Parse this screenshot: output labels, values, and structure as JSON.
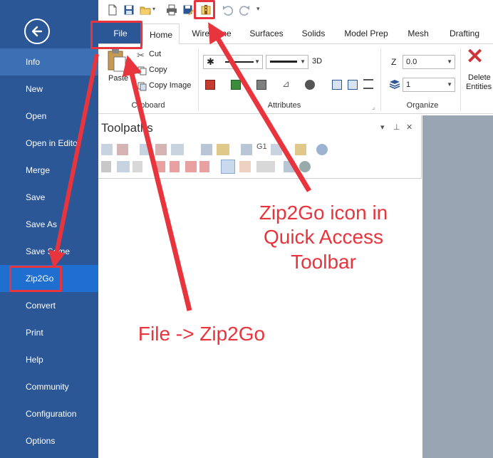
{
  "backstage": {
    "items": [
      {
        "label": "Info"
      },
      {
        "label": "New"
      },
      {
        "label": "Open"
      },
      {
        "label": "Open in Edito"
      },
      {
        "label": "Merge"
      },
      {
        "label": "Save"
      },
      {
        "label": "Save As"
      },
      {
        "label": "Save Some"
      },
      {
        "label": "Zip2Go"
      },
      {
        "label": "Convert"
      },
      {
        "label": "Print"
      },
      {
        "label": "Help"
      },
      {
        "label": "Community"
      },
      {
        "label": "Configuration"
      },
      {
        "label": "Options"
      }
    ],
    "selected": "Info",
    "highlighted": "Zip2Go"
  },
  "tabs": [
    "File",
    "Home",
    "Wireframe",
    "Surfaces",
    "Solids",
    "Model Prep",
    "Mesh",
    "Drafting"
  ],
  "ribbon": {
    "clipboard": {
      "paste": "Paste",
      "cut": "Cut",
      "copy": "Copy",
      "copy_image": "Copy Image",
      "group": "Clipboard"
    },
    "attributes": {
      "three_d": "3D",
      "group": "Attributes"
    },
    "organize": {
      "z_label": "Z",
      "z_value": "0.0",
      "level_value": "1",
      "group": "Organize"
    },
    "delete": {
      "line1": "Delete",
      "line2": "Entities"
    }
  },
  "panel": {
    "title": "Toolpaths"
  },
  "annotations": {
    "qat_line1": "Zip2Go icon in",
    "qat_line2": "Quick Access",
    "qat_line3": "Toolbar",
    "file_note": "File -> Zip2Go"
  },
  "colors": {
    "backstage": "#2b5797",
    "annotation": "#e8343c"
  }
}
